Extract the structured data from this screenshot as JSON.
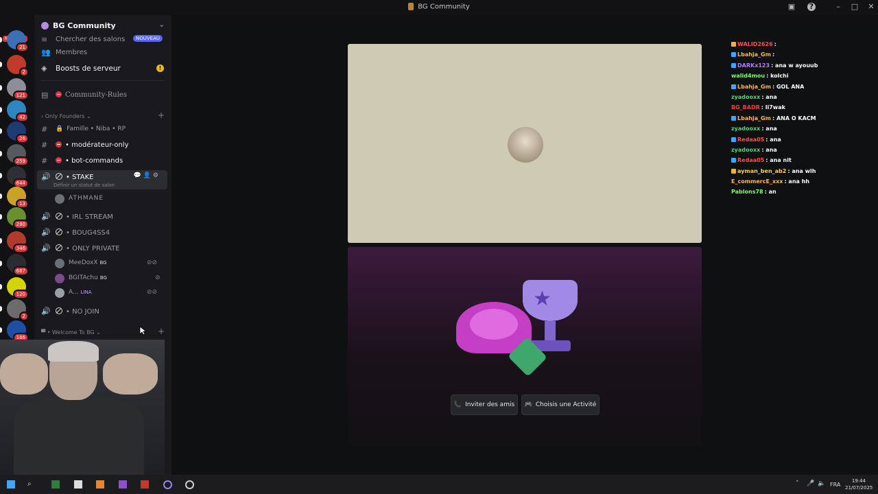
{
  "window": {
    "title": "BG Community"
  },
  "servers": [
    {
      "badge": "21"
    },
    {
      "badge": "2"
    },
    {
      "badge": "121"
    },
    {
      "badge": "42"
    },
    {
      "badge": "26"
    },
    {
      "badge": "259"
    },
    {
      "badge": "644"
    },
    {
      "badge": "13"
    },
    {
      "badge": "280"
    },
    {
      "badge": "346"
    },
    {
      "badge": "687"
    },
    {
      "badge": "120"
    },
    {
      "badge": "2"
    },
    {
      "badge": "186"
    },
    {
      "badge": "61"
    }
  ],
  "server_top_badge": "NOUVEAU",
  "sidebar": {
    "server_name": "BG Community",
    "browse_channels": "Chercher des salons",
    "browse_badge": "NOUVEAU",
    "members": "Membres",
    "boosts": "Boosts de serveur",
    "rules_channel": "Community-Rules",
    "category_founders": "Only Founders",
    "channel_famille": "Famille • Niba • RP",
    "channel_moderateur": "modérateur-only",
    "channel_bot": "bot-commands",
    "voice_stake": "STAKE",
    "voice_stake_status": "Définir un statut de salon",
    "user_athmane": "ATHMANE",
    "voice_irl": "IRL STREAM",
    "voice_boug": "BOUG4SS4",
    "voice_private": "ONLY PRIVATE",
    "user_1": "MeeDoxX",
    "user_1_tag": "BG",
    "user_2": "BGITAchu",
    "user_2_tag": "BG",
    "user_3": "A...",
    "user_3_tag": "LINA",
    "voice_nojoin": "NO JOIN",
    "category_welcome": "Welcome To BG",
    "notif_count": "1"
  },
  "actions": {
    "invite": "Inviter des amis",
    "activity": "Choisis une Activité"
  },
  "chat": [
    {
      "user": "WALID2626",
      "text": ":",
      "color": "#ff4d4d",
      "badge": "#f0b232"
    },
    {
      "user": "Lbahja_Gm",
      "text": ":",
      "color": "#ffb84d",
      "badge": "#3ea6ff"
    },
    {
      "user": "DARKx123",
      "text": ": ana w ayouub",
      "color": "#b57bff",
      "badge": "#3ea6ff"
    },
    {
      "user": "walid4mou",
      "text": ": kolchi",
      "color": "#7cff6b",
      "badge": ""
    },
    {
      "user": "Lbahja_Gm",
      "text": ": GOL ANA",
      "color": "#ffb84d",
      "badge": "#3ea6ff"
    },
    {
      "user": "zyadooxx",
      "text": ": ana",
      "color": "#4dd97a",
      "badge": ""
    },
    {
      "user": "BG_BADR",
      "text": ": li7wak",
      "color": "#ff3b3b",
      "badge": ""
    },
    {
      "user": "Lbahja_Gm",
      "text": ": ANA O KACM",
      "color": "#ffb84d",
      "badge": "#3ea6ff"
    },
    {
      "user": "zyadooxx",
      "text": ": ana",
      "color": "#4dd97a",
      "badge": ""
    },
    {
      "user": "Redaa05",
      "text": ": ana",
      "color": "#ff4d4d",
      "badge": "#3ea6ff"
    },
    {
      "user": "zyadooxx",
      "text": ": ana",
      "color": "#4dd97a",
      "badge": ""
    },
    {
      "user": "Redaa05",
      "text": ": ana nit",
      "color": "#ff4d4d",
      "badge": "#3ea6ff"
    },
    {
      "user": "ayman_ben_ab2",
      "text": ": ana wlh",
      "color": "#ffd24d",
      "badge": "#f0b232"
    },
    {
      "user": "E_commercE_xxx",
      "text": ": ana hh",
      "color": "#ffb84d",
      "badge": ""
    },
    {
      "user": "Pablons78",
      "text": ": an",
      "color": "#7cff6b",
      "badge": ""
    }
  ],
  "taskbar": {
    "lang": "FRA",
    "time": "19:44",
    "date": "21/07/2025"
  },
  "colors": {
    "accent": "#5865f2",
    "danger": "#da373c",
    "background": "#0f1012"
  },
  "icons": [
    "windows-start-icon",
    "search-icon",
    "speaker-icon",
    "mic-icon",
    "help-icon",
    "gear-icon",
    "trophy-icon",
    "gamepad-icon",
    "invite-icon"
  ]
}
